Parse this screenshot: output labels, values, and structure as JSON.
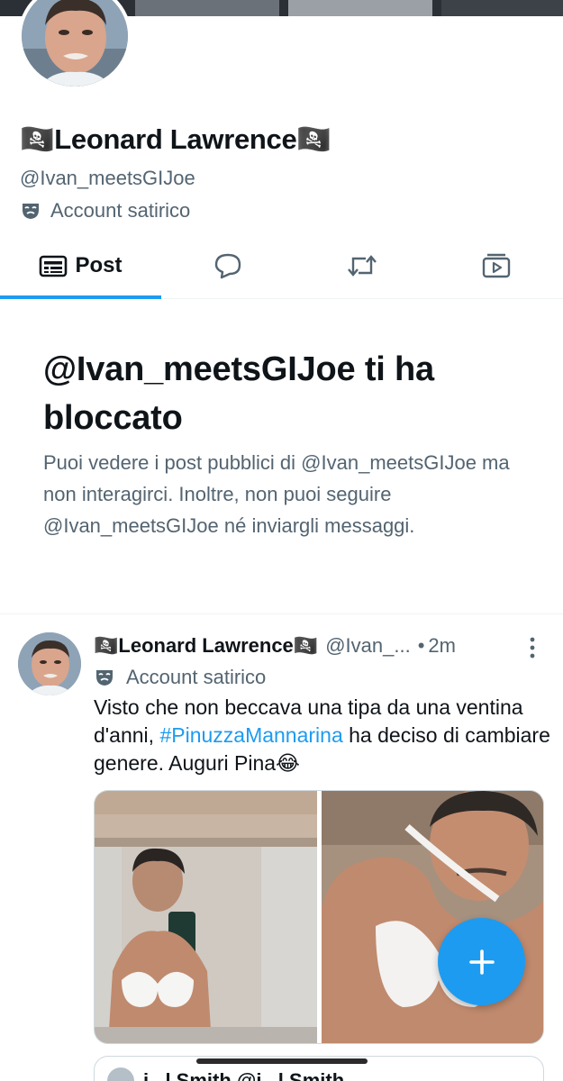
{
  "profile": {
    "display_name": "🏴‍☠️Leonard Lawrence🏴‍☠️",
    "handle": "@Ivan_meetsGIJoe",
    "label": "Account satirico"
  },
  "tabs": [
    {
      "label": "Post",
      "icon": "post-list-icon",
      "active": true
    },
    {
      "label": "",
      "icon": "replies-bubble-icon"
    },
    {
      "label": "",
      "icon": "repost-icon"
    },
    {
      "label": "",
      "icon": "media-play-icon"
    }
  ],
  "blocked": {
    "title": "@Ivan_meetsGIJoe ti ha bloccato",
    "description": "Puoi vedere i post pubblici di @Ivan_meetsGIJoe ma non interagirci. Inoltre, non puoi seguire @Ivan_meetsGIJoe né inviargli messaggi."
  },
  "post": {
    "name": "🏴‍☠️Leonard Lawrence🏴‍☠️",
    "handle": "@Ivan_...",
    "dot": "•",
    "time": "2m",
    "label": "Account satirico",
    "text_before": "Visto che non beccava una tipa da una ventina d'anni, ",
    "hashtag": "#PinuzzaMannarina",
    "text_after": " ha deciso di cambiare genere. Auguri Pina😂"
  },
  "quoted": {
    "name": "j...l  Smith  @j...l  Smith..."
  },
  "colors": {
    "accent": "#1d9bf0",
    "text": "#0f1419",
    "secondary": "#536471",
    "border": "#eff3f4"
  }
}
